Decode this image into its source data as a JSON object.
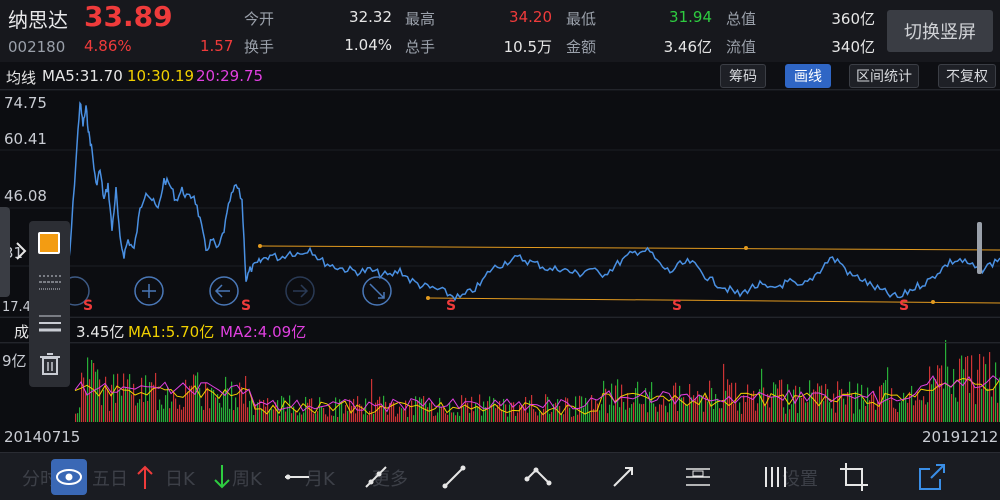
{
  "header": {
    "name": "纳思达",
    "price": "33.89",
    "code": "002180",
    "pct": "4.86%",
    "change": "1.57",
    "stats": [
      {
        "label": "今开",
        "value": "32.32",
        "color": "#e6e6e6"
      },
      {
        "label": "最高",
        "value": "34.20",
        "color": "#ef3b3b"
      },
      {
        "label": "最低",
        "value": "31.94",
        "color": "#2ecc40"
      },
      {
        "label": "总值",
        "value": "360亿",
        "color": "#e6e6e6"
      },
      {
        "label": "换手",
        "value": "1.04%",
        "color": "#e6e6e6"
      },
      {
        "label": "总手",
        "value": "10.5万",
        "color": "#e6e6e6"
      },
      {
        "label": "金额",
        "value": "3.46亿",
        "color": "#e6e6e6"
      },
      {
        "label": "流值",
        "value": "340亿",
        "color": "#e6e6e6"
      }
    ],
    "switch_label": "切换竖屏"
  },
  "ma_bar": {
    "label": "均线",
    "ma5": "MA5:31.70",
    "ma10": "10:30.19",
    "ma20": "20:29.75"
  },
  "tools": [
    "筹码",
    "画线",
    "区间统计",
    "不复权"
  ],
  "price_axis": [
    "74.75",
    "60.41",
    "46.08",
    "31",
    "17.4"
  ],
  "volume_bar": {
    "label": "成",
    "vol": "3.45亿",
    "ma1": "MA1:5.70亿",
    "ma2": "MA2:4.09亿",
    "axis": "9亿"
  },
  "dates": {
    "start": "20140715",
    "end": "20191212"
  },
  "bottom_toolbar": {
    "ghost_labels": [
      "分时",
      "五日",
      "日K",
      "周K",
      "月K",
      "更多",
      "设置"
    ]
  },
  "colors": {
    "up": "#ef3b3b",
    "down": "#2ecc40",
    "line": "#4a90e2",
    "ma5": "#e6e6e6",
    "ma10": "#f0d000",
    "ma20": "#e040e0",
    "trend": "#e39a1f",
    "marker": "#ef3b3b"
  },
  "chart_data": {
    "type": "line",
    "y_ticks": [
      74.75,
      60.41,
      46.08,
      31,
      17.4
    ],
    "markers": [
      "S",
      "S",
      "S",
      "S",
      "S"
    ]
  }
}
